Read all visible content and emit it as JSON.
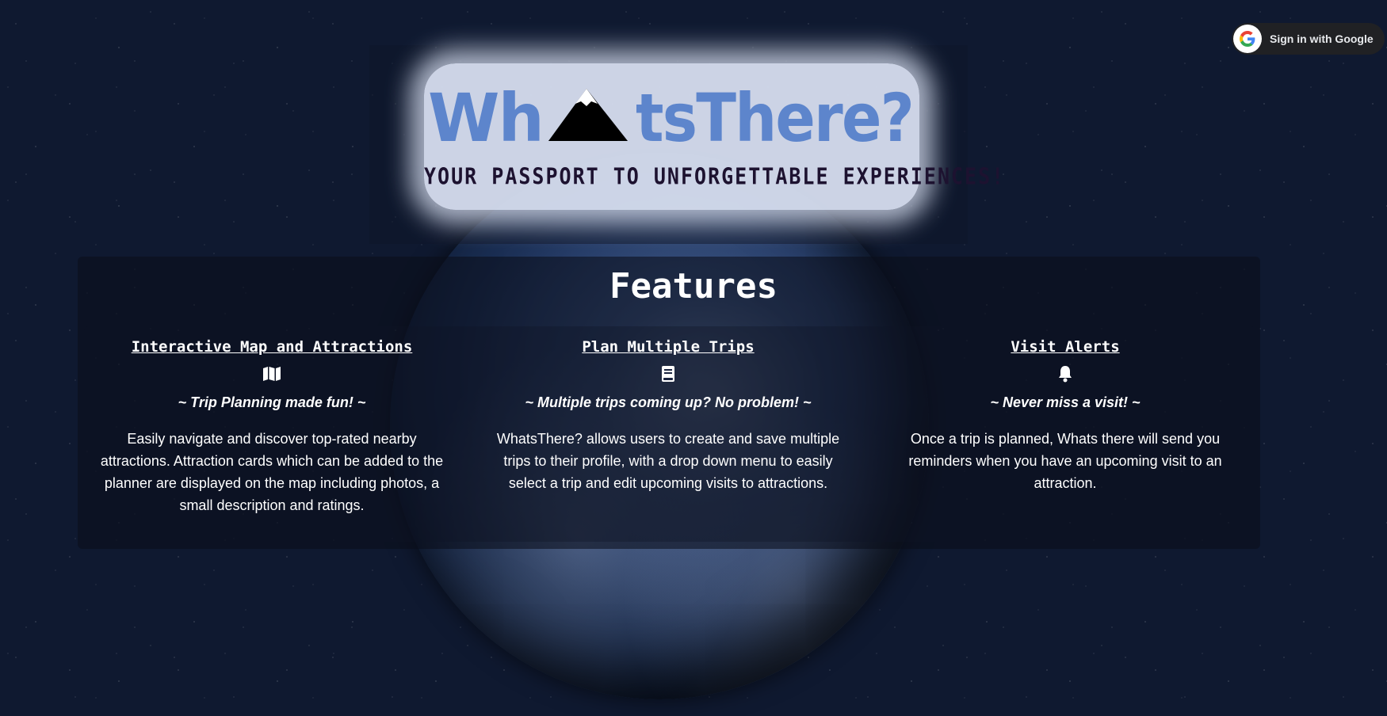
{
  "header": {
    "signin_label": "Sign in with Google"
  },
  "hero": {
    "logo_before": "Wh",
    "logo_after": "tsThere?",
    "tagline": "YOUR PASSPORT TO UNFORGETTABLE EXPERIENCES!"
  },
  "features": {
    "title": "Features",
    "items": [
      {
        "title": "Interactive Map and Attractions",
        "icon": "map-icon",
        "slogan": "~ Trip Planning made fun! ~",
        "description": "Easily navigate and discover top-rated nearby attractions. Attraction cards which can be added to the planner are displayed on the map including photos, a small description and ratings."
      },
      {
        "title": "Plan Multiple Trips",
        "icon": "book-icon",
        "slogan": "~ Multiple trips coming up? No problem! ~",
        "description": "WhatsThere? allows users to create and save multiple trips to their profile, with a drop down menu to easily select a trip and edit upcoming visits to attractions."
      },
      {
        "title": "Visit Alerts",
        "icon": "bell-icon",
        "slogan": "~ Never miss a visit! ~",
        "description": "Once a trip is planned, Whats there will send you reminders when you have an upcoming visit to an attraction."
      }
    ]
  },
  "colors": {
    "background": "#0f1930",
    "logo": "#5d85cc",
    "tagline": "#1d1230",
    "google_button": "#202124"
  }
}
